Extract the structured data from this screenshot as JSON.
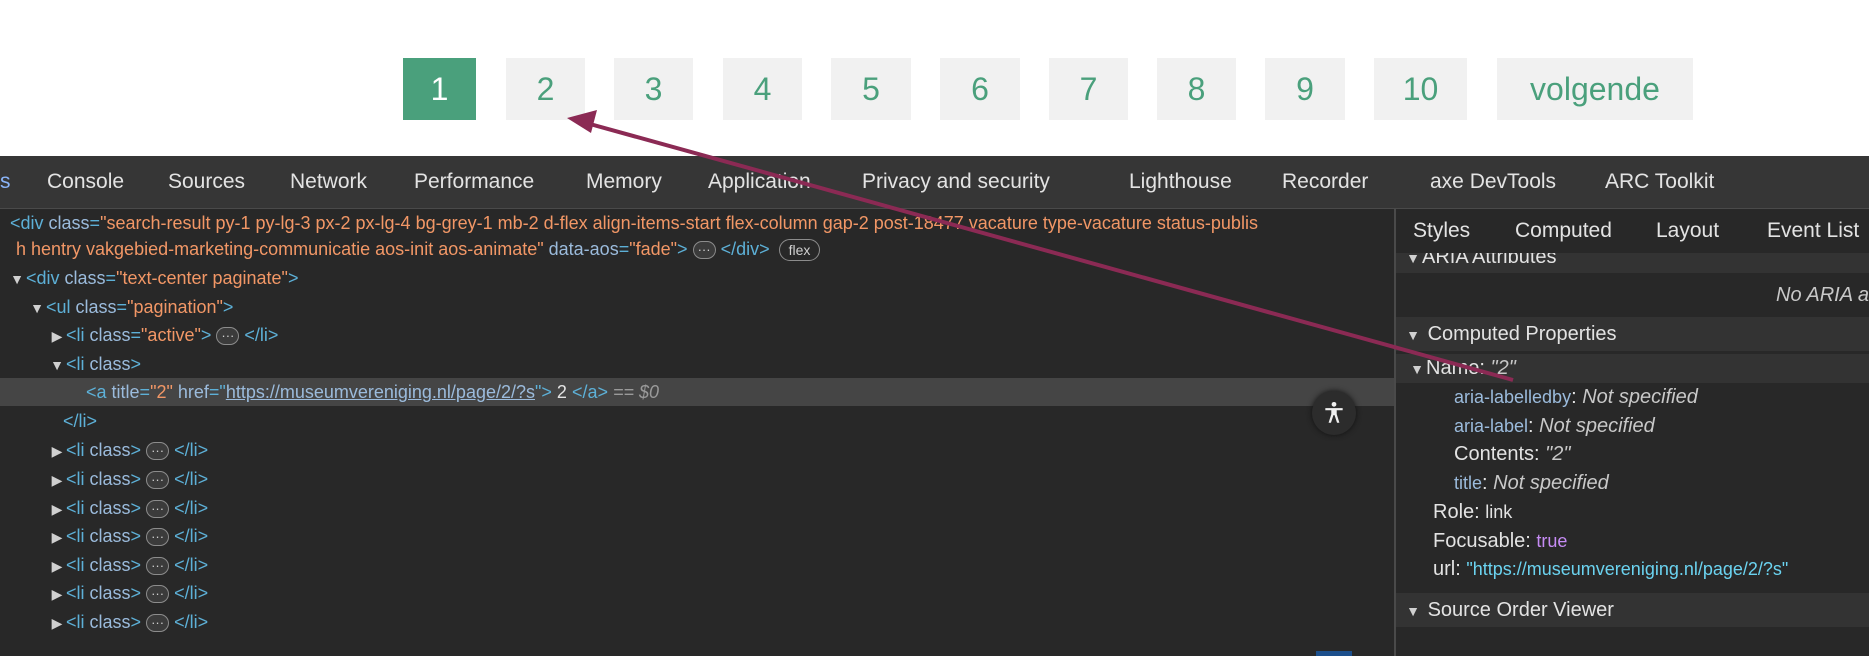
{
  "pagination": {
    "pages": [
      "1",
      "2",
      "3",
      "4",
      "5",
      "6",
      "7",
      "8",
      "9",
      "10"
    ],
    "next_label": "volgende",
    "active_page": "1"
  },
  "devtools": {
    "tabs": [
      "s",
      "Console",
      "Sources",
      "Network",
      "Performance",
      "Memory",
      "Application",
      "Privacy and security",
      "Lighthouse",
      "Recorder",
      "axe DevTools",
      "ARC Toolkit"
    ],
    "elements": {
      "line1": {
        "tag_open": "<div ",
        "attr": "class",
        "value": "\"search-result py-1 py-lg-3 px-2 px-lg-4 bg-grey-1 mb-2 d-flex align-items-start flex-column gap-2 post-18477 vacature type-vacature status-publis"
      },
      "line2": {
        "value": "h hentry vakgebied-marketing-communicatie aos-init aos-animate\"",
        "attr2": " data-aos",
        "value2": "\"fade\"",
        "close": "</div>",
        "badge": "flex"
      },
      "line3": {
        "tag": "<div ",
        "attr": "class",
        "value": "\"text-center paginate\"",
        "end": ">"
      },
      "line4": {
        "tag": "<ul ",
        "attr": "class",
        "value": "\"pagination\"",
        "end": ">"
      },
      "line5": {
        "tag": "<li ",
        "attr": "class",
        "value": "\"active\"",
        "end": ">",
        "close": "</li>"
      },
      "line6": {
        "tag": "<li ",
        "attr": "class",
        "end": ">"
      },
      "line7": {
        "tag": "<a ",
        "attr_title": "title",
        "title_value": "\"2\"",
        "attr_href": "href",
        "href_value": "https://museumvereniging.nl/page/2/?s",
        "text": "2",
        "close": "</a>",
        "dollar": "== $0"
      },
      "line8": {
        "close": "</li>"
      },
      "collapsed_li": {
        "tag": "<li ",
        "attr": "class",
        "end": ">",
        "close": "</li>"
      }
    },
    "sidebar": {
      "tabs": [
        "Styles",
        "Computed",
        "Layout",
        "Event List"
      ],
      "aria_attributes": "ARIA Attributes",
      "no_aria": "No ARIA a",
      "computed_properties": "Computed Properties",
      "name_label": "Name: ",
      "name_value": "\"2\"",
      "props": [
        {
          "key": "aria-labelledby",
          "value": "Not specified"
        },
        {
          "key": "aria-label",
          "value": "Not specified"
        }
      ],
      "contents_label": "Contents: ",
      "contents_value": "\"2\"",
      "title_key": "title",
      "title_value": "Not specified",
      "role_label": "Role: ",
      "role_value": "link",
      "focusable_label": "Focusable: ",
      "focusable_value": "true",
      "url_label": "url",
      "url_value": "\"https://museumvereniging.nl/page/2/?s\"",
      "source_order": "Source Order Viewer"
    },
    "colors": {
      "panel_bg": "#282828",
      "accent_green": "#4aa07c",
      "arrow": "#8b2a54"
    },
    "icons": [
      "accessibility-icon",
      "triangle-right-icon",
      "triangle-down-icon"
    ]
  }
}
